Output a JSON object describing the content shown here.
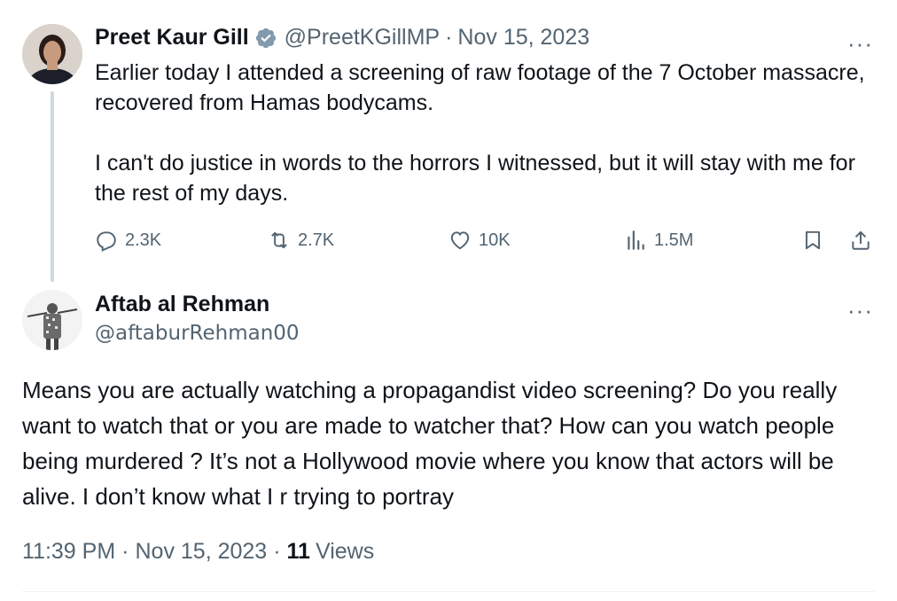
{
  "tweet": {
    "author_name": "Preet Kaur Gill",
    "handle": "@PreetKGillMP",
    "separator": "·",
    "date": "Nov 15, 2023",
    "text": "Earlier today I attended a screening of raw footage of the 7 October massacre, recovered from Hamas bodycams.\n\nI can't do justice in words to the horrors I witnessed, but it will stay with me for the rest of my days.",
    "more_label": "···",
    "actions": {
      "replies": "2.3K",
      "reposts": "2.7K",
      "likes": "10K",
      "views": "1.5M"
    },
    "icons": [
      "verified-icon",
      "reply-icon",
      "repost-icon",
      "like-icon",
      "views-icon",
      "bookmark-icon",
      "share-icon"
    ]
  },
  "reply": {
    "author_name": "Aftab al Rehman",
    "handle": "@aftaburRehman00",
    "more_label": "···",
    "text": "Means you are actually watching a propagandist video screening? Do you really want to watch that or you are made to watcher that? How can you watch people being murdered ? It’s not a Hollywood movie where you know that actors will be alive. I don’t know what I r trying to portray",
    "time": "11:39 PM",
    "separator1": "·",
    "date": "Nov 15, 2023",
    "separator2": "·",
    "views_count": "11",
    "views_label": "Views"
  },
  "colors": {
    "text": "#0f1419",
    "muted": "#536471",
    "verified": "#829aab",
    "thread_line": "#cfd9de",
    "divider": "#eff3f4"
  }
}
